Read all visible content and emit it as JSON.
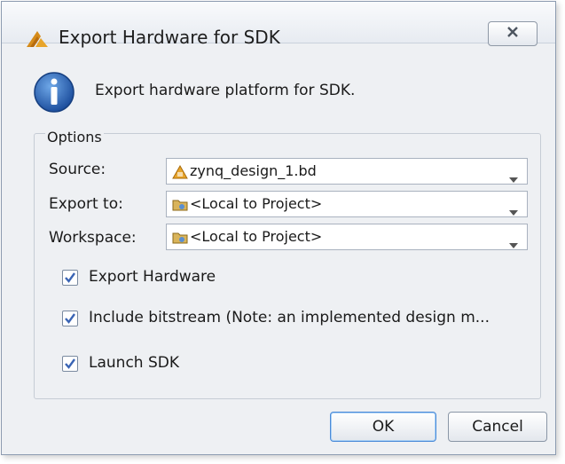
{
  "dialog": {
    "title": "Export Hardware for SDK",
    "close_icon": "close-icon",
    "info_icon": "info-icon",
    "description": "Export hardware platform for SDK."
  },
  "options": {
    "legend": "Options",
    "source": {
      "label": "Source:",
      "value": "zynq_design_1.bd",
      "icon": "block-design-icon"
    },
    "export_to": {
      "label": "Export to:",
      "value": "<Local to Project>",
      "icon": "folder-icon"
    },
    "workspace": {
      "label": "Workspace:",
      "value": "<Local to Project>",
      "icon": "folder-icon"
    },
    "checkboxes": [
      {
        "label": "Export Hardware",
        "checked": true
      },
      {
        "label": "Include bitstream (Note: an implemented design m...",
        "checked": true
      },
      {
        "label": "Launch SDK",
        "checked": true
      }
    ]
  },
  "buttons": {
    "ok": "OK",
    "cancel": "Cancel"
  },
  "colors": {
    "check": "#3a64b4",
    "dialog_bg": "#eef0f3"
  }
}
